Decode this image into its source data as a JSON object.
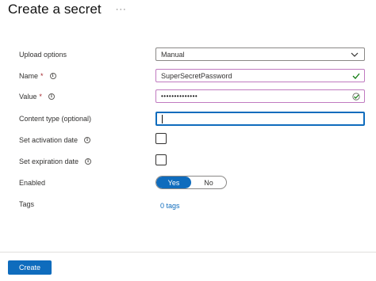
{
  "header": {
    "title": "Create a secret",
    "more_icon": "ellipsis-icon"
  },
  "form": {
    "upload_options": {
      "label": "Upload options",
      "value": "Manual"
    },
    "name": {
      "label": "Name",
      "required_mark": "*",
      "value": "SuperSecretPassword"
    },
    "value": {
      "label": "Value",
      "required_mark": "*",
      "masked_value": "••••••••••••••"
    },
    "content_type": {
      "label": "Content type (optional)",
      "value": ""
    },
    "activation": {
      "label": "Set activation date",
      "checked": false
    },
    "expiration": {
      "label": "Set expiration date",
      "checked": false
    },
    "enabled": {
      "label": "Enabled",
      "yes": "Yes",
      "no": "No",
      "selected": "Yes"
    },
    "tags": {
      "label": "Tags",
      "link": "0 tags"
    }
  },
  "footer": {
    "create_label": "Create"
  },
  "colors": {
    "accent": "#0f6cbd",
    "valid_border": "#c07ac0",
    "valid_check": "#107c10",
    "required": "#a4262c"
  }
}
